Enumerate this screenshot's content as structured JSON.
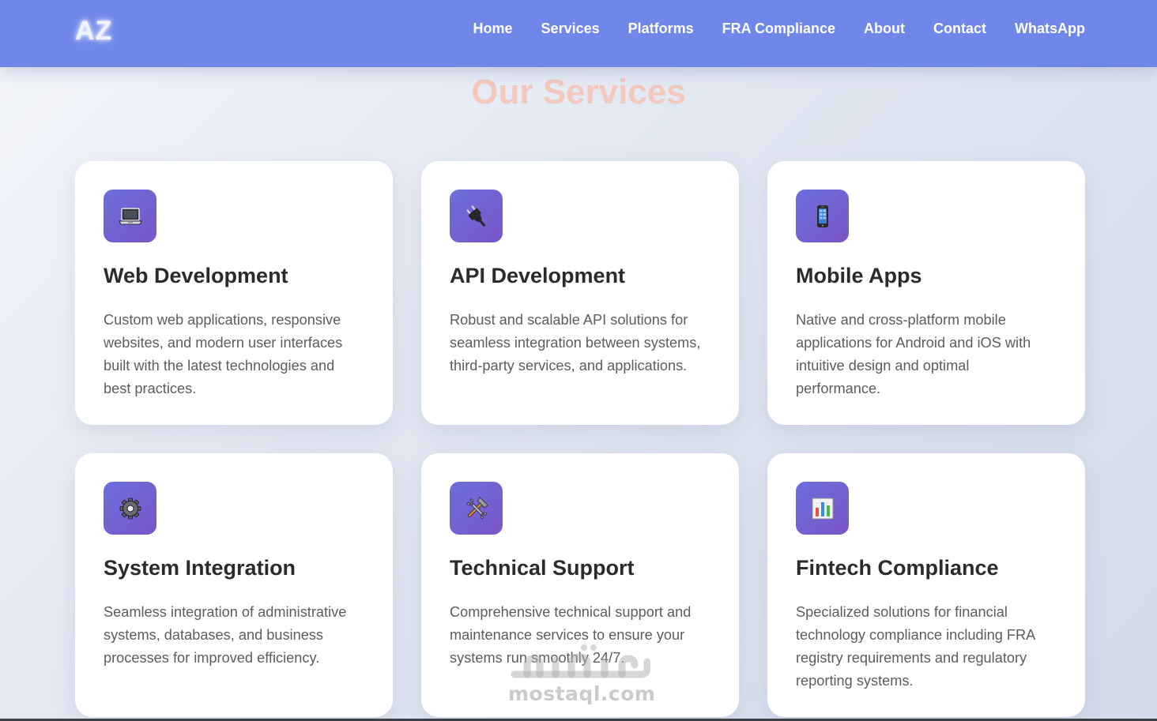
{
  "nav": {
    "logo": "AZ",
    "links": [
      "Home",
      "Services",
      "Platforms",
      "FRA Compliance",
      "About",
      "Contact",
      "WhatsApp"
    ]
  },
  "section": {
    "title": "Our Services"
  },
  "cards": [
    {
      "icon": "laptop-icon",
      "title": "Web Development",
      "description": "Custom web applications, responsive websites, and modern user interfaces built with the latest technologies and best practices."
    },
    {
      "icon": "plug-icon",
      "title": "API Development",
      "description": "Robust and scalable API solutions for seamless integration between systems, third-party services, and applications."
    },
    {
      "icon": "mobile-phone-icon",
      "title": "Mobile Apps",
      "description": "Native and cross-platform mobile applications for Android and iOS with intuitive design and optimal performance."
    },
    {
      "icon": "gear-icon",
      "title": "System Integration",
      "description": "Seamless integration of administrative systems, databases, and business processes for improved efficiency."
    },
    {
      "icon": "tools-icon",
      "title": "Technical Support",
      "description": "Comprehensive technical support and maintenance services to ensure your systems run smoothly 24/7."
    },
    {
      "icon": "bar-chart-icon",
      "title": "Fintech Compliance",
      "description": "Specialized solutions for financial technology compliance including FRA registry requirements and regulatory reporting systems."
    }
  ],
  "watermark": {
    "text": "mostaql.com"
  },
  "colors": {
    "nav_bg": "#6e87e8",
    "title": "#f3c8bd",
    "icon_gradient_start": "#6a6fdc",
    "icon_gradient_end": "#7b55c8"
  }
}
